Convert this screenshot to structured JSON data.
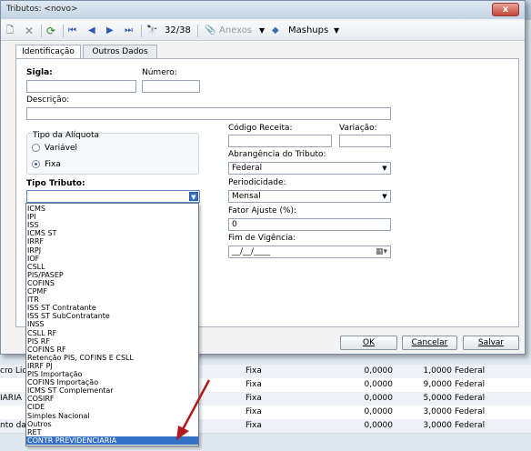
{
  "window": {
    "title": "Tributos: <novo>",
    "close": "x"
  },
  "toolbar": {
    "record_count": "32/38",
    "anexos_label": "Anexos",
    "mashups_label": "Mashups"
  },
  "tabs": [
    {
      "label": "Identificação"
    },
    {
      "label": "Outros Dados"
    }
  ],
  "form": {
    "sigla_label": "Sigla:",
    "numero_label": "Número:",
    "descricao_label": "Descrição:",
    "aliquota_group_label": "Tipo da Alíquota",
    "aliquota_options": [
      "Variável",
      "Fixa"
    ],
    "tipo_tributo_label": "Tipo Tributo:",
    "codigo_receita_label": "Código Receita:",
    "variacao_label": "Variação:",
    "abrangencia_label": "Abrangência do Tributo:",
    "abrangencia_value": "Federal",
    "periodicidade_label": "Periodicidade:",
    "periodicidade_value": "Mensal",
    "fator_ajuste_label": "Fator Ajuste (%):",
    "fator_ajuste_value": "0",
    "fim_vigencia_label": "Fim de Vigência:",
    "fim_vigencia_value": "__/__/____"
  },
  "buttons": {
    "ok": "OK",
    "cancelar": "Cancelar",
    "salvar": "Salvar"
  },
  "dropdown_items": [
    "ICMS",
    "IPI",
    "ISS",
    "ICMS ST",
    "IRRF",
    "IRPJ",
    "IOF",
    "CSLL",
    "PIS/PASEP",
    "COFINS",
    "CPMF",
    "ITR",
    "ISS ST Contratante",
    "ISS ST SubContratante",
    "INSS",
    "CSLL RF",
    "PIS RF",
    "COFINS RF",
    "Retenção PIS, COFINS E CSLL",
    "IRRF PJ",
    "PIS Importação",
    "COFINS Importação",
    "ICMS ST Complementar",
    "COSIRF",
    "CIDE",
    "Simples Nacional",
    "Outros",
    "RET",
    "CONTR PREVIDENCIARIA"
  ],
  "background_rows": [
    {
      "left": "cro Liq",
      "tipo": "Fixa",
      "v1": "0,0000",
      "v2": "1,0000",
      "abr": "Federal"
    },
    {
      "left": "",
      "tipo": "Fixa",
      "v1": "0,0000",
      "v2": "9,0000",
      "abr": "Federal"
    },
    {
      "left": "IARIA",
      "tipo": "Fixa",
      "v1": "0,0000",
      "v2": "5,0000",
      "abr": "Federal"
    },
    {
      "left": "",
      "tipo": "Fixa",
      "v1": "0,0000",
      "v2": "3,0000",
      "abr": "Federal"
    },
    {
      "left": "nto da",
      "tipo": "Fixa",
      "v1": "0,0000",
      "v2": "3,0000",
      "abr": "Federal"
    }
  ],
  "colors": {
    "selection": "#3670c4",
    "annotation_arrow": "#b3191f"
  }
}
